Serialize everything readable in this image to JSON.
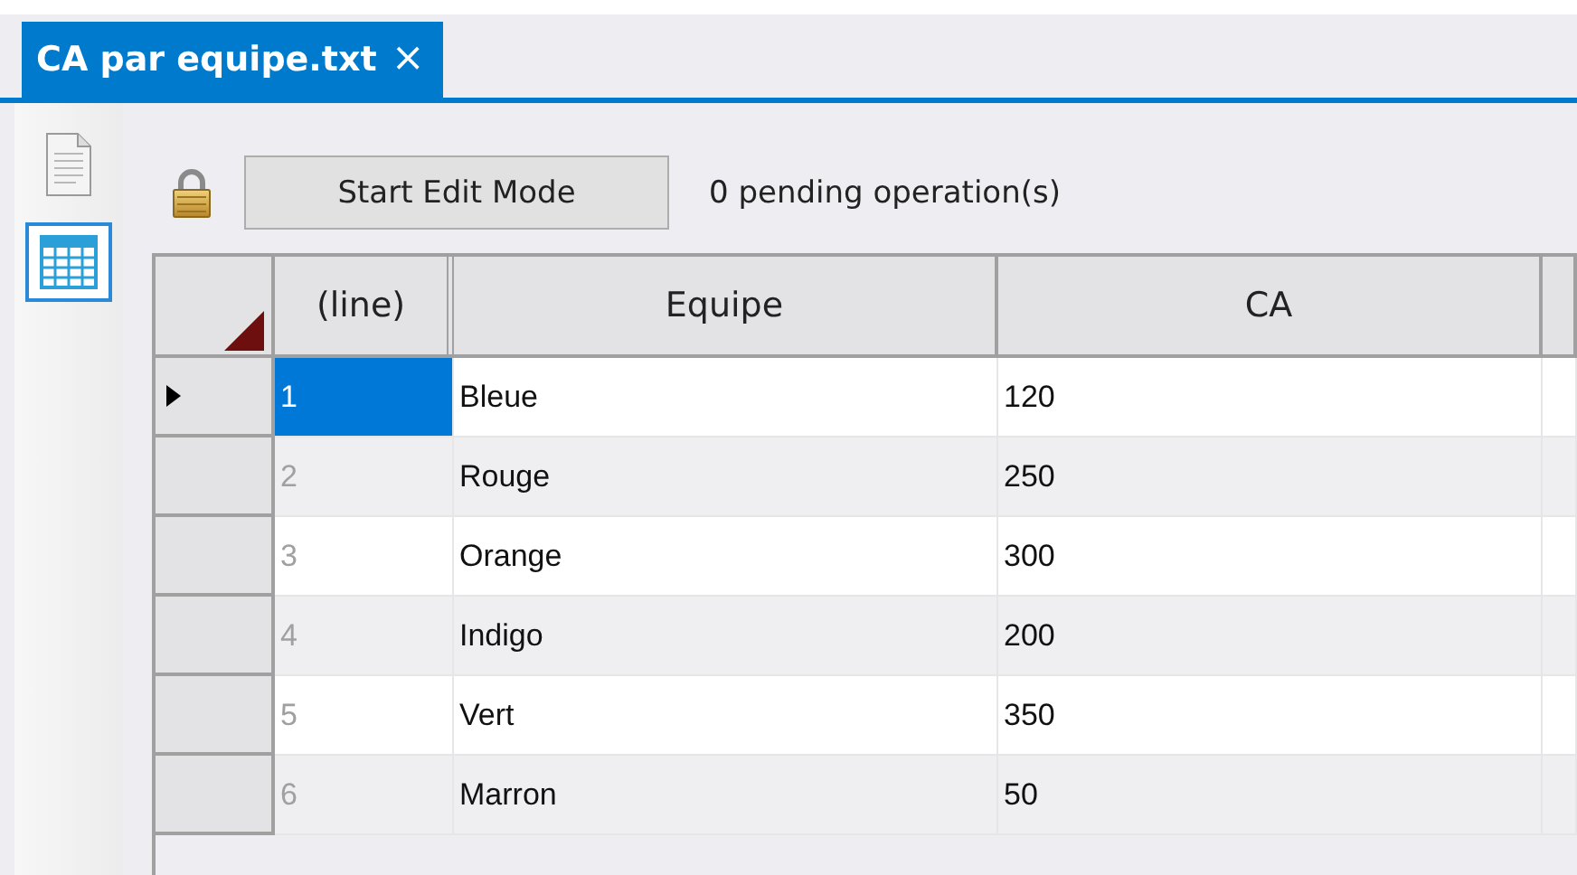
{
  "tab": {
    "title": "CA par equipe.txt",
    "close": "×",
    "selected": true
  },
  "sidebar": {
    "items": [
      {
        "kind": "document",
        "selected": false
      },
      {
        "kind": "grid",
        "selected": true
      }
    ]
  },
  "toolbar": {
    "locked": true,
    "button": "Start Edit Mode",
    "status": "0 pending operation(s)"
  },
  "table": {
    "columns": [
      "(line)",
      "Equipe",
      "CA"
    ],
    "rows": [
      {
        "line": "1",
        "cells": [
          "Bleue",
          "120"
        ],
        "current": true,
        "selected": true
      },
      {
        "line": "2",
        "cells": [
          "Rouge",
          "250"
        ],
        "current": false,
        "selected": false
      },
      {
        "line": "3",
        "cells": [
          "Orange",
          "300"
        ],
        "current": false,
        "selected": false
      },
      {
        "line": "4",
        "cells": [
          "Indigo",
          "200"
        ],
        "current": false,
        "selected": false
      },
      {
        "line": "5",
        "cells": [
          "Vert",
          "350"
        ],
        "current": false,
        "selected": false
      },
      {
        "line": "6",
        "cells": [
          "Marron",
          "50"
        ],
        "current": false,
        "selected": false
      }
    ]
  }
}
